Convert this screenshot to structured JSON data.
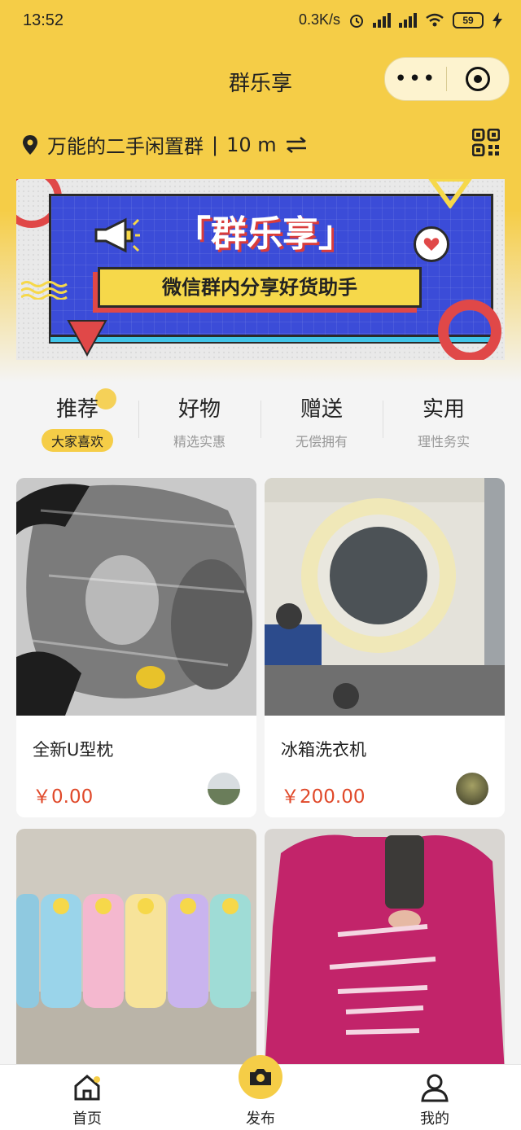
{
  "status_bar": {
    "time": "13:52",
    "network_speed": "0.3K/s",
    "battery": "59"
  },
  "navbar": {
    "title": "群乐享",
    "more_label": "•••"
  },
  "location": {
    "group_name": "万能的二手闲置群",
    "separator": "|",
    "distance": "10 m"
  },
  "banner": {
    "title": "「群乐享」",
    "subtitle": "微信群内分享好货助手"
  },
  "tabs": [
    {
      "label": "推荐",
      "sub": "大家喜欢",
      "active": true
    },
    {
      "label": "好物",
      "sub": "精选实惠",
      "active": false
    },
    {
      "label": "赠送",
      "sub": "无偿拥有",
      "active": false
    },
    {
      "label": "实用",
      "sub": "理性务实",
      "active": false
    }
  ],
  "products": [
    {
      "name": "全新U型枕",
      "price": "￥0.00"
    },
    {
      "name": "冰箱洗衣机",
      "price": "￥200.00"
    },
    {
      "name": "",
      "price": ""
    },
    {
      "name": "",
      "price": ""
    }
  ],
  "tabbar": {
    "home": "首页",
    "publish": "发布",
    "mine": "我的"
  },
  "colors": {
    "accent": "#f5cd47",
    "price": "#e0492a"
  }
}
